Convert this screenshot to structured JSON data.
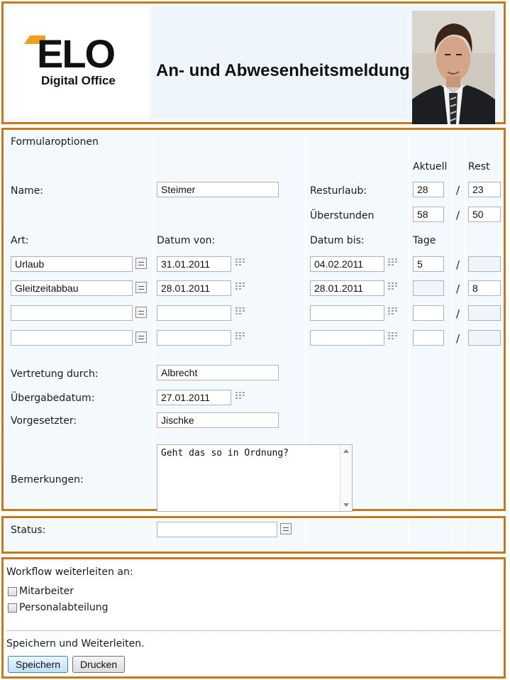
{
  "header": {
    "logo_big": "ELO",
    "logo_small": "Digital Office",
    "title": "An- und Abwesenheitsmeldung",
    "photo_alt": "employee-photo"
  },
  "form": {
    "section_title": "Formularoptionen",
    "col_aktuell": "Aktuell",
    "col_rest": "Rest",
    "name_label": "Name:",
    "name_value": "Steimer",
    "resturlaub_label": "Resturlaub:",
    "resturlaub_aktuell": "28",
    "resturlaub_rest": "23",
    "ueberstunden_label": "Überstunden",
    "ueberstunden_aktuell": "58",
    "ueberstunden_rest": "50",
    "art_label": "Art:",
    "datum_von_label": "Datum von:",
    "datum_bis_label": "Datum bis:",
    "tage_label": "Tage",
    "rows": [
      {
        "art": "Urlaub",
        "von": "31.01.2011",
        "bis": "04.02.2011",
        "tage": "5",
        "rest": ""
      },
      {
        "art": "Gleitzeitabbau",
        "von": "28.01.2011",
        "bis": "28.01.2011",
        "tage": "",
        "rest": "8"
      },
      {
        "art": "",
        "von": "",
        "bis": "",
        "tage": "",
        "rest": ""
      },
      {
        "art": "",
        "von": "",
        "bis": "",
        "tage": "",
        "rest": ""
      }
    ],
    "slash": "/",
    "vertretung_label": "Vertretung durch:",
    "vertretung_value": "Albrecht",
    "uebergabe_label": "Übergabedatum:",
    "uebergabe_value": "27.01.2011",
    "vorgesetzter_label": "Vorgesetzter:",
    "vorgesetzter_value": "Jischke",
    "bemerkungen_label": "Bemerkungen:",
    "bemerkungen_value": "Geht das so in Ordnung?"
  },
  "status": {
    "label": "Status:",
    "value": ""
  },
  "workflow": {
    "title": "Workflow weiterleiten an:",
    "option_1": "Mitarbeiter",
    "option_2": "Personalabteilung",
    "save_text": "Speichern und Weiterleiten.",
    "save_button": "Speichern",
    "print_button": "Drucken"
  },
  "colors": {
    "frame": "#c47a1a",
    "logo_accent": "#f0a020",
    "panel_bg": "#f4f9fd"
  },
  "icons": [
    "list-picker-icon",
    "calendar-icon",
    "checkbox-icon"
  ]
}
